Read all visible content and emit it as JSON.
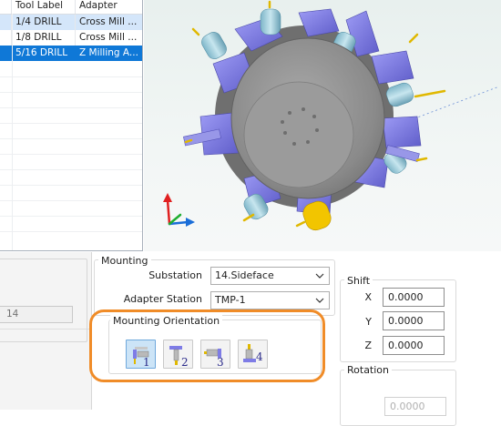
{
  "tool_table": {
    "columns": [
      "",
      "Tool Label",
      "Adapter"
    ],
    "rows": [
      {
        "tool_label": "1/4 DRILL",
        "adapter": "Cross Mill ...",
        "state": "hover"
      },
      {
        "tool_label": "1/8 DRILL",
        "adapter": "Cross Mill ...",
        "state": "normal"
      },
      {
        "tool_label": "5/16 DRILL",
        "adapter": "Z Milling A...",
        "state": "selected"
      }
    ]
  },
  "mounting": {
    "title": "Mounting",
    "substation_label": "Substation",
    "substation_value": "14.Sideface",
    "adapter_station_label": "Adapter Station",
    "adapter_station_value": "TMP-1"
  },
  "orientation": {
    "title": "Mounting Orientation",
    "buttons": [
      {
        "number": "1",
        "icon": "orientation-1-icon",
        "selected": true
      },
      {
        "number": "2",
        "icon": "orientation-2-icon",
        "selected": false
      },
      {
        "number": "3",
        "icon": "orientation-3-icon",
        "selected": false
      },
      {
        "number": "4",
        "icon": "orientation-4-icon",
        "selected": false
      }
    ],
    "highlight_color": "#f08c28"
  },
  "shift": {
    "title": "Shift",
    "x_label": "X",
    "x_value": "0.0000",
    "y_label": "Y",
    "y_value": "0.0000",
    "z_label": "Z",
    "z_value": "0.0000"
  },
  "rotation": {
    "title": "Rotation",
    "value": "0.0000"
  },
  "left_field_value": "14",
  "colors": {
    "selection": "#0f78d7",
    "hover_row": "#d4e6fa",
    "tool_holder": "#7e7ce6",
    "turret_body": "#8c8c8c",
    "cutter": "#f2c500"
  }
}
